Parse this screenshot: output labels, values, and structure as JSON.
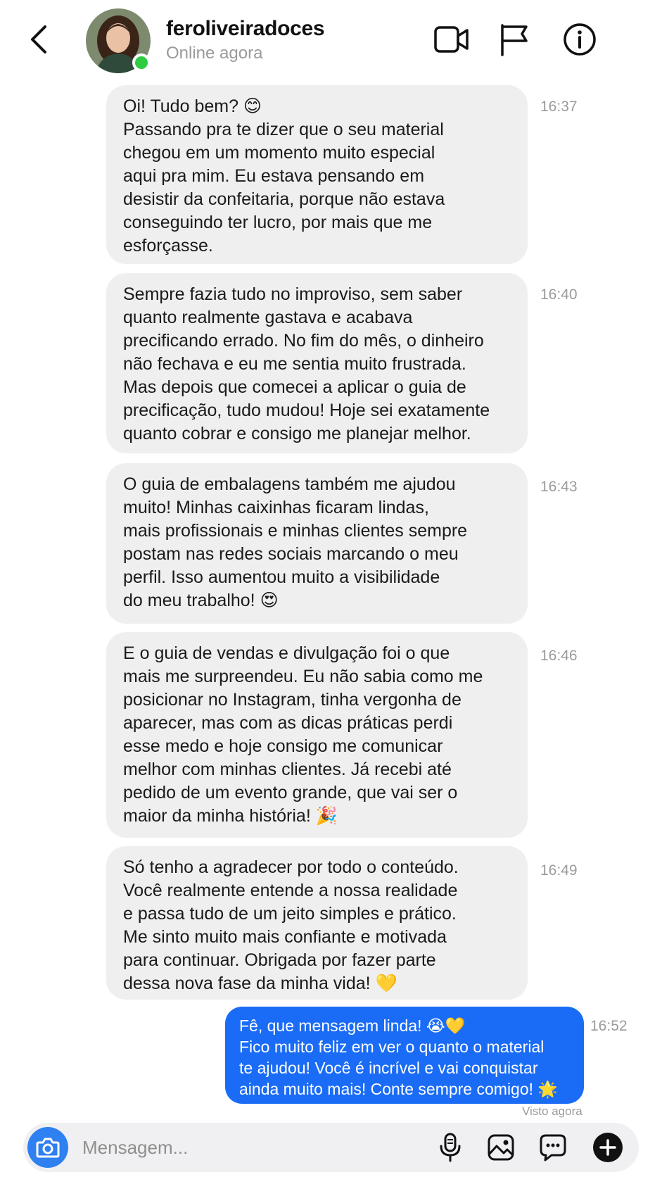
{
  "header": {
    "username": "feroliveiradoces",
    "status": "Online agora"
  },
  "messages": [
    {
      "from": "them",
      "text": "Oi! Tudo bem? 😊\nPassando pra te dizer que o seu material\nchegou em um momento muito especial\naqui pra mim. Eu estava pensando em\ndesistir da confeitaria, porque não estava\nconseguindo ter lucro, por mais que me\nesforçasse.",
      "time": "16:37"
    },
    {
      "from": "them",
      "text": "Sempre fazia tudo no improviso, sem saber\nquanto realmente gastava e acabava\nprecificando errado. No fim do mês, o dinheiro\nnão fechava e eu me sentia muito frustrada.\nMas depois que comecei a aplicar o guia de\nprecificação, tudo mudou! Hoje sei exatamente\nquanto cobrar e consigo me planejar melhor.",
      "time": "16:40"
    },
    {
      "from": "them",
      "text": "O guia de embalagens também me ajudou\nmuito! Minhas caixinhas ficaram lindas,\nmais profissionais e minhas clientes sempre\npostam nas redes sociais marcando o meu\nperfil. Isso aumentou muito a visibilidade\ndo meu trabalho! 😍",
      "time": "16:43"
    },
    {
      "from": "them",
      "text": "E o guia de vendas e divulgação foi o que\nmais me surpreendeu. Eu não sabia como me\nposicionar no Instagram, tinha vergonha de\naparecer, mas com as dicas práticas perdi\nesse medo e hoje consigo me comunicar\nmelhor com minhas clientes. Já recebi até\npedido de um evento grande, que vai ser o\nmaior da minha história! 🎉",
      "time": "16:46"
    },
    {
      "from": "them",
      "text": "Só tenho a agradecer por todo o conteúdo.\nVocê realmente entende a nossa realidade\ne passa tudo de um jeito simples e prático.\nMe sinto muito mais confiante e motivada\npara continuar. Obrigada por fazer parte\ndessa nova fase da minha vida! 💛",
      "time": "16:49"
    },
    {
      "from": "me",
      "text": "Fê, que mensagem linda! 😭💛\nFico muito feliz em ver o quanto o material\nte ajudou! Você é incrível e vai conquistar\nainda muito mais! Conte sempre comigo! 🌟",
      "time": "16:52"
    }
  ],
  "seen_label": "Visto agora",
  "composer": {
    "placeholder": "Mensagem..."
  },
  "icons": {
    "back": "chevron-left-icon",
    "video": "video-camera-icon",
    "report": "flag-icon",
    "info": "info-icon",
    "camera": "camera-icon",
    "mic": "microphone-icon",
    "gallery": "image-icon",
    "sticker": "chat-bubble-icon",
    "add": "plus-icon"
  },
  "colors": {
    "outgoing_bubble": "#1a6cf6",
    "incoming_bubble": "#efefef",
    "online": "#2ecc40",
    "camera_button": "#2f80f0"
  }
}
